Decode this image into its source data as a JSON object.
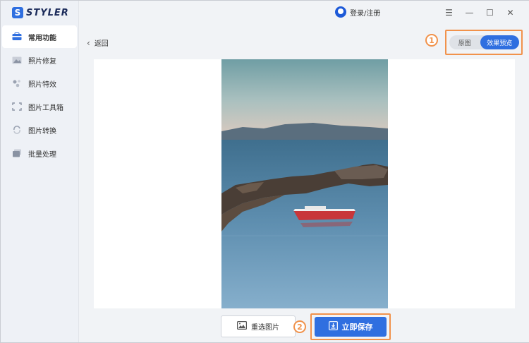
{
  "app": {
    "logo_letter": "S",
    "name": "STYLER"
  },
  "sidebar": {
    "items": [
      {
        "label": "常用功能",
        "icon": "toolbox-icon",
        "active": true
      },
      {
        "label": "照片修复",
        "icon": "photo-repair-icon",
        "active": false
      },
      {
        "label": "照片特效",
        "icon": "sparkle-icon",
        "active": false
      },
      {
        "label": "图片工具箱",
        "icon": "crop-frame-icon",
        "active": false
      },
      {
        "label": "图片转换",
        "icon": "convert-icon",
        "active": false
      },
      {
        "label": "批量处理",
        "icon": "batch-icon",
        "active": false
      }
    ]
  },
  "titlebar": {
    "login_label": "登录/注册",
    "controls": {
      "menu": "☰",
      "minimize": "—",
      "maximize": "☐",
      "close": "✕"
    }
  },
  "main": {
    "back_label": "返回",
    "toggle": {
      "original_label": "原图",
      "preview_label": "效果预览",
      "selected": "效果预览"
    },
    "annotations": {
      "badge1": "1",
      "badge2": "2"
    },
    "reselect_label": "重选图片",
    "save_label": "立即保存"
  },
  "colors": {
    "accent": "#2f6fe0",
    "highlight": "#f1924b",
    "sidebar_bg": "#eef1f6"
  }
}
